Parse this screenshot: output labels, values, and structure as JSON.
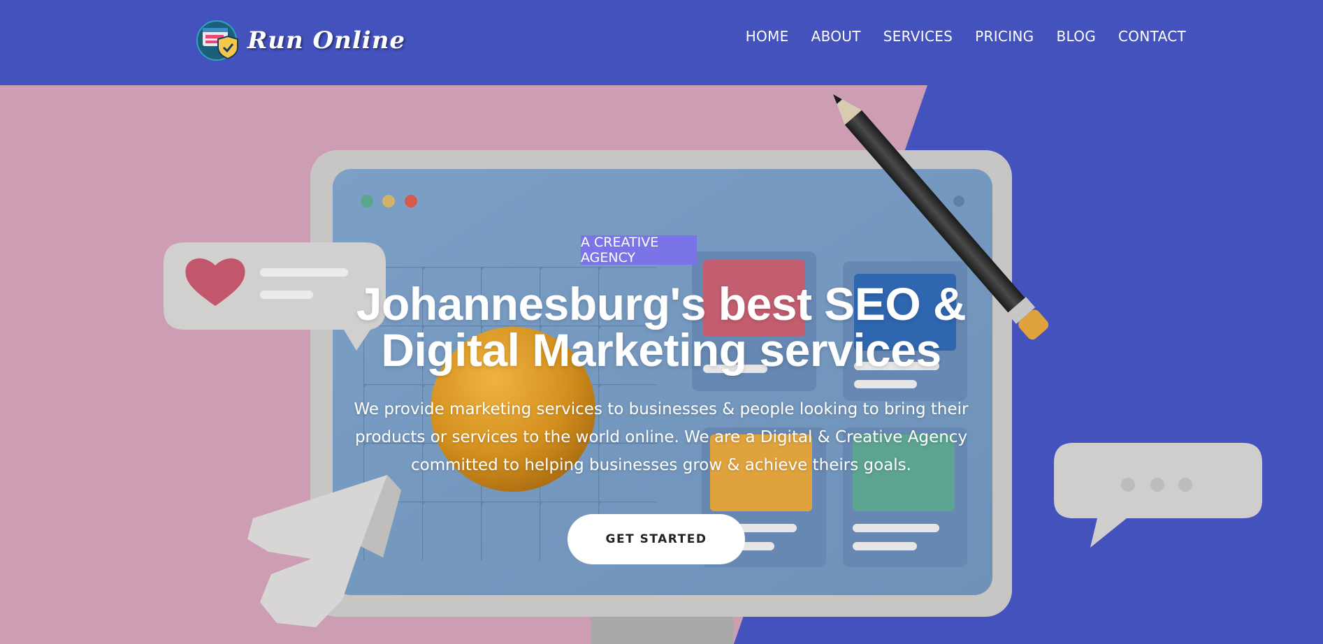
{
  "brand": {
    "name": "Run Online"
  },
  "nav": {
    "items": [
      {
        "label": "HOME"
      },
      {
        "label": "ABOUT"
      },
      {
        "label": "SERVICES"
      },
      {
        "label": "PRICING"
      },
      {
        "label": "BLOG"
      },
      {
        "label": "CONTACT"
      }
    ]
  },
  "hero": {
    "badge": "A CREATIVE AGENCY",
    "headline_line1": "Johannesburg's best SEO &",
    "headline_line2": "Digital Marketing services",
    "subtext_line1": "We provide marketing services to businesses & people looking to bring their",
    "subtext_line2": "products or services to the world online. We are a Digital & Creative Agency",
    "subtext_line3": "committed to helping businesses grow & achieve theirs goals.",
    "cta_label": "GET STARTED"
  },
  "colors": {
    "primary": "#4452bd",
    "pink_bg": "#cc9db3",
    "badge": "#7a74e8",
    "screen": "#7b9fc4"
  },
  "icons": {
    "logo": "browser-shield-icon",
    "heart": "heart-icon",
    "pencil": "pencil-icon",
    "cursor": "cursor-arrow-icon",
    "chat": "chat-bubble-icon"
  }
}
